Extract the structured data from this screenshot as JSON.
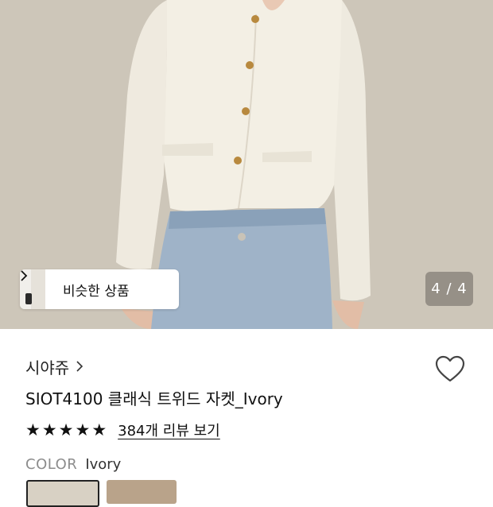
{
  "gallery": {
    "image_alt": "",
    "similar_label": "비슷한 상품",
    "counter": "4 / 4"
  },
  "product": {
    "brand": "시야쥬",
    "title": "SIOT4100 클래식 트위드 자켓_Ivory",
    "rating_stars": 5,
    "review_link": "384개 리뷰 보기",
    "color_label": "COLOR",
    "color_value": "Ivory"
  },
  "icons": {
    "chevron": "chevron-right-icon",
    "heart": "heart-outline-icon",
    "star": "star-icon"
  }
}
